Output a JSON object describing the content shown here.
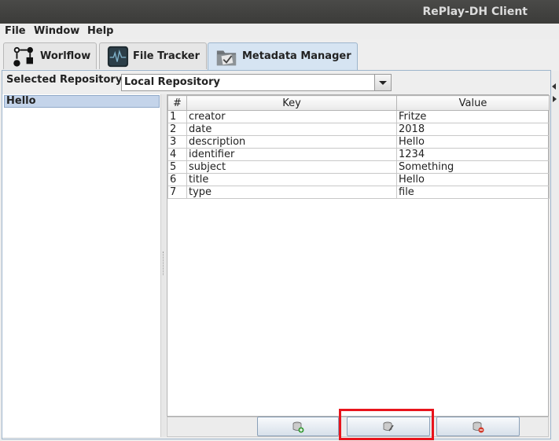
{
  "window": {
    "title": "RePlay-DH Client"
  },
  "menu": [
    "File",
    "Window",
    "Help"
  ],
  "tabs": [
    {
      "label": "Worlflow",
      "icon": "workflow-icon",
      "active": false
    },
    {
      "label": "File Tracker",
      "icon": "file-tracker-icon",
      "active": false
    },
    {
      "label": "Metadata Manager",
      "icon": "folder-checked-icon",
      "active": true
    }
  ],
  "repository": {
    "label": "Selected Repository",
    "selected": "Local Repository"
  },
  "records": {
    "items": [
      "Hello"
    ],
    "selected_index": 0
  },
  "table": {
    "columns": [
      "#",
      "Key",
      "Value"
    ],
    "rows": [
      [
        "1",
        "creator",
        "Fritze"
      ],
      [
        "2",
        "date",
        "2018"
      ],
      [
        "3",
        "description",
        "Hello"
      ],
      [
        "4",
        "identifier",
        "1234"
      ],
      [
        "5",
        "subject",
        "Something"
      ],
      [
        "6",
        "title",
        "Hello"
      ],
      [
        "7",
        "type",
        "file"
      ]
    ]
  },
  "actions": [
    {
      "name": "add-entry-button",
      "icon": "database-add-icon"
    },
    {
      "name": "edit-entry-button",
      "icon": "database-edit-icon",
      "highlighted": true
    },
    {
      "name": "remove-entry-button",
      "icon": "database-remove-icon"
    }
  ],
  "colors": {
    "accent": "#d6e4f2",
    "selection": "#c4d4ea",
    "highlight": "#e8141c",
    "titlebar": "#3b3b39"
  }
}
